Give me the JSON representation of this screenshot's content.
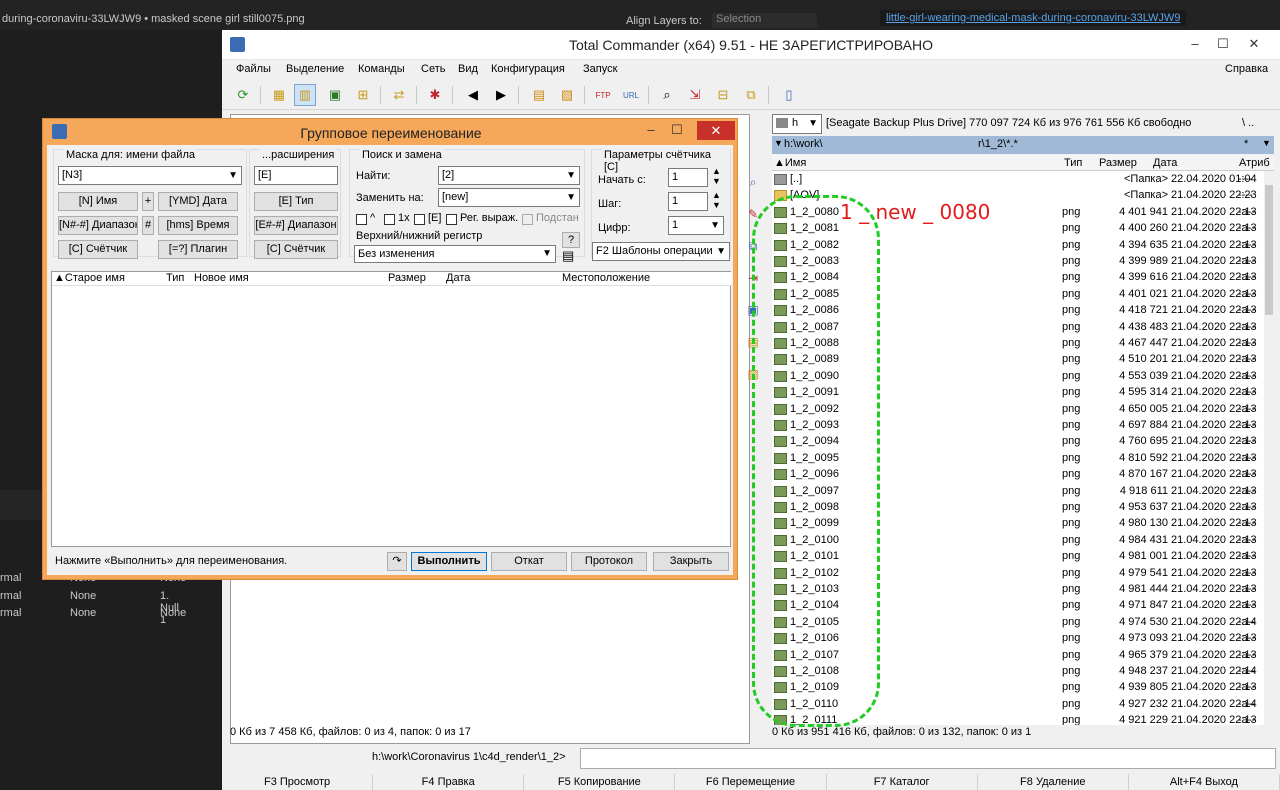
{
  "background": {
    "top_left_text": "during-coronaviru-33LWJW9 • masked scene girl still0075.png",
    "align_label": "Align Layers to:",
    "align_value": "Selection",
    "composition_tab": "little-girl-wearing-medical-mask-during-coronaviru-33LWJW9",
    "layers": [
      {
        "mode": "rmal",
        "parent": "None",
        "name": "None"
      },
      {
        "mode": "rmal",
        "parent": "None",
        "name": "1. Null 1"
      },
      {
        "mode": "rmal",
        "parent": "None",
        "name": "None"
      }
    ]
  },
  "tc": {
    "title": "Total Commander (x64) 9.51 - НЕ ЗАРЕГИСТРИРОВАНО",
    "menu": [
      "Файлы",
      "Выделение",
      "Команды",
      "Сеть",
      "Вид",
      "Конфигурация",
      "Запуск"
    ],
    "menu_help": "Справка",
    "drive": "h",
    "drive_info": "[Seagate Backup Plus Drive]  770 097 724 Кб из 976 761 556 Кб свободно",
    "drive_extra": "\\   ..",
    "path": "h:\\work\\",
    "path_tail": "r\\1_2\\*.*",
    "path_star": "*",
    "columns": {
      "name": "Имя",
      "type": "Тип",
      "size": "Размер",
      "date": "Дата",
      "attr": "Атриб"
    },
    "files": [
      {
        "name": "[..]",
        "type": "",
        "size": "<Папка>",
        "date": "22.04.2020 01:04",
        "attr": "----"
      },
      {
        "name": "[AOV]",
        "type": "",
        "size": "<Папка>",
        "date": "21.04.2020 22:23",
        "attr": "----"
      },
      {
        "name": "1_2_0080",
        "type": "png",
        "size": "4 401 941",
        "date": "21.04.2020 22:13",
        "attr": "-a--"
      },
      {
        "name": "1_2_0081",
        "type": "png",
        "size": "4 400 260",
        "date": "21.04.2020 22:13",
        "attr": "-a--"
      },
      {
        "name": "1_2_0082",
        "type": "png",
        "size": "4 394 635",
        "date": "21.04.2020 22:13",
        "attr": "-a--"
      },
      {
        "name": "1_2_0083",
        "type": "png",
        "size": "4 399 989",
        "date": "21.04.2020 22:13",
        "attr": "-a--"
      },
      {
        "name": "1_2_0084",
        "type": "png",
        "size": "4 399 616",
        "date": "21.04.2020 22:13",
        "attr": "-a--"
      },
      {
        "name": "1_2_0085",
        "type": "png",
        "size": "4 401 021",
        "date": "21.04.2020 22:13",
        "attr": "-a--"
      },
      {
        "name": "1_2_0086",
        "type": "png",
        "size": "4 418 721",
        "date": "21.04.2020 22:13",
        "attr": "-a--"
      },
      {
        "name": "1_2_0087",
        "type": "png",
        "size": "4 438 483",
        "date": "21.04.2020 22:13",
        "attr": "-a--"
      },
      {
        "name": "1_2_0088",
        "type": "png",
        "size": "4 467 447",
        "date": "21.04.2020 22:13",
        "attr": "-a--"
      },
      {
        "name": "1_2_0089",
        "type": "png",
        "size": "4 510 201",
        "date": "21.04.2020 22:13",
        "attr": "-a--"
      },
      {
        "name": "1_2_0090",
        "type": "png",
        "size": "4 553 039",
        "date": "21.04.2020 22:13",
        "attr": "-a--"
      },
      {
        "name": "1_2_0091",
        "type": "png",
        "size": "4 595 314",
        "date": "21.04.2020 22:13",
        "attr": "-a--"
      },
      {
        "name": "1_2_0092",
        "type": "png",
        "size": "4 650 005",
        "date": "21.04.2020 22:13",
        "attr": "-a--"
      },
      {
        "name": "1_2_0093",
        "type": "png",
        "size": "4 697 884",
        "date": "21.04.2020 22:13",
        "attr": "-a--"
      },
      {
        "name": "1_2_0094",
        "type": "png",
        "size": "4 760 695",
        "date": "21.04.2020 22:13",
        "attr": "-a--"
      },
      {
        "name": "1_2_0095",
        "type": "png",
        "size": "4 810 592",
        "date": "21.04.2020 22:13",
        "attr": "-a--"
      },
      {
        "name": "1_2_0096",
        "type": "png",
        "size": "4 870 167",
        "date": "21.04.2020 22:13",
        "attr": "-a--"
      },
      {
        "name": "1_2_0097",
        "type": "png",
        "size": "4 918 611",
        "date": "21.04.2020 22:13",
        "attr": "-a--"
      },
      {
        "name": "1_2_0098",
        "type": "png",
        "size": "4 953 637",
        "date": "21.04.2020 22:13",
        "attr": "-a--"
      },
      {
        "name": "1_2_0099",
        "type": "png",
        "size": "4 980 130",
        "date": "21.04.2020 22:13",
        "attr": "-a--"
      },
      {
        "name": "1_2_0100",
        "type": "png",
        "size": "4 984 431",
        "date": "21.04.2020 22:13",
        "attr": "-a--"
      },
      {
        "name": "1_2_0101",
        "type": "png",
        "size": "4 981 001",
        "date": "21.04.2020 22:13",
        "attr": "-a--"
      },
      {
        "name": "1_2_0102",
        "type": "png",
        "size": "4 979 541",
        "date": "21.04.2020 22:13",
        "attr": "-a--"
      },
      {
        "name": "1_2_0103",
        "type": "png",
        "size": "4 981 444",
        "date": "21.04.2020 22:13",
        "attr": "-a--"
      },
      {
        "name": "1_2_0104",
        "type": "png",
        "size": "4 971 847",
        "date": "21.04.2020 22:13",
        "attr": "-a--"
      },
      {
        "name": "1_2_0105",
        "type": "png",
        "size": "4 974 530",
        "date": "21.04.2020 22:14",
        "attr": "-a--"
      },
      {
        "name": "1_2_0106",
        "type": "png",
        "size": "4 973 093",
        "date": "21.04.2020 22:13",
        "attr": "-a--"
      },
      {
        "name": "1_2_0107",
        "type": "png",
        "size": "4 965 379",
        "date": "21.04.2020 22:13",
        "attr": "-a--"
      },
      {
        "name": "1_2_0108",
        "type": "png",
        "size": "4 948 237",
        "date": "21.04.2020 22:14",
        "attr": "-a--"
      },
      {
        "name": "1_2_0109",
        "type": "png",
        "size": "4 939 805",
        "date": "21.04.2020 22:13",
        "attr": "-a--"
      },
      {
        "name": "1_2_0110",
        "type": "png",
        "size": "4 927 232",
        "date": "21.04.2020 22:14",
        "attr": "-a--"
      },
      {
        "name": "1_2_0111",
        "type": "png",
        "size": "4 921 229",
        "date": "21.04.2020 22:13",
        "attr": "-a--"
      }
    ],
    "status_left": "0 Кб из 7 458 Кб, файлов: 0 из 4, папок: 0 из 17",
    "status_right": "0 Кб из 951 416 Кб, файлов: 0 из 132, папок: 0 из 1",
    "cmd_path": "h:\\work\\Coronavirus 1\\c4d_render\\1_2>",
    "fkeys": [
      "F3 Просмотр",
      "F4 Правка",
      "F5 Копирование",
      "F6 Перемещение",
      "F7 Каталог",
      "F8 Удаление",
      "Alt+F4 Выход"
    ]
  },
  "dialog": {
    "title": "Групповое переименование",
    "mask_group": "Маска для: имени файла",
    "mask_value": "[N3]",
    "btn_name": "[N]      Имя",
    "btn_plus": "+",
    "btn_ymd": "[YMD] Дата",
    "btn_range": "[N#-#] Диапазон",
    "btn_hash": "#",
    "btn_hms": "[hms]  Время",
    "btn_counter": "[C]     Счётчик",
    "btn_plugin": "[=?]     Плагин",
    "ext_group": "...расширения",
    "ext_value": "[E]",
    "btn_ext_type": "[E]       Тип",
    "btn_ext_range": "[E#-#] Диапазон",
    "btn_ext_counter": "[C]     Счётчик",
    "search_group": "Поиск и замена",
    "find_label": "Найти:",
    "find_value": "[2]",
    "replace_label": "Заменить на:",
    "replace_value": "[new]",
    "chk_caret": "^",
    "chk_1x": "1x",
    "chk_e": "[E]",
    "chk_regex": "Рег. выраж.",
    "chk_subst": "Подстан",
    "case_group": "Верхний/нижний регистр",
    "case_value": "Без изменения",
    "help_btn": "?",
    "counter_group": "Параметры счётчика [C]",
    "start_label": "Начать с:",
    "start_value": "1",
    "step_label": "Шаг:",
    "step_value": "1",
    "digits_label": "Цифр:",
    "digits_value": "1",
    "templates_value": "F2 Шаблоны операции",
    "list_cols": {
      "old": "Старое имя",
      "type": "Тип",
      "new": "Новое имя",
      "size": "Размер",
      "date": "Дата",
      "location": "Местоположение"
    },
    "hint": "Нажмите «Выполнить» для переименования.",
    "btn_run": "Выполнить",
    "btn_undo": "Откат",
    "btn_log": "Протокол",
    "btn_close": "Закрыть"
  },
  "annotation": {
    "text": "1 _ new _ 0080",
    "color": "#e21c1c",
    "oval_color": "#22cc22"
  }
}
